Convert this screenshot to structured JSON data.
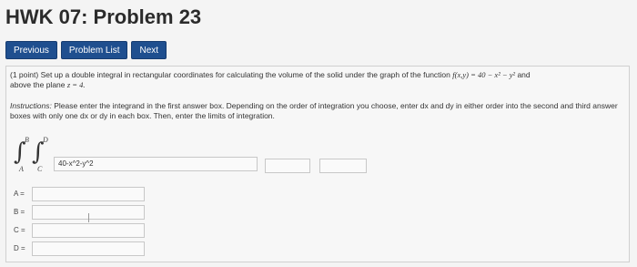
{
  "header": {
    "title": "HWK 07: Problem 23"
  },
  "nav": {
    "previous": "Previous",
    "problem_list": "Problem List",
    "next": "Next"
  },
  "problem": {
    "points": "(1 point)",
    "statement_text": "Set up a double integral in rectangular coordinates for calculating the volume of the solid under the graph of the function",
    "function_expr": "f(x,y) = 40 − x² − y²",
    "and_text": "and",
    "statement_text_2": "above the plane",
    "plane_expr": "z = 4.",
    "instructions_label": "Instructions:",
    "instructions_text": "Please enter the integrand in the first answer box. Depending on the order of integration you choose, enter dx and dy in either order into the second and third answer boxes with only one dx or dy in each box. Then, enter the limits of integration."
  },
  "integral": {
    "outer_upper": "B",
    "outer_lower": "A",
    "inner_upper": "D",
    "inner_lower": "C",
    "integrand_value": "40-x^2-y^2",
    "diff1_value": "",
    "diff2_value": ""
  },
  "limits": [
    {
      "label": "A =",
      "value": ""
    },
    {
      "label": "B =",
      "value": ""
    },
    {
      "label": "C =",
      "value": ""
    },
    {
      "label": "D =",
      "value": ""
    }
  ],
  "colors": {
    "button_bg": "#1f4f8f",
    "background": "#f4f4f4"
  }
}
